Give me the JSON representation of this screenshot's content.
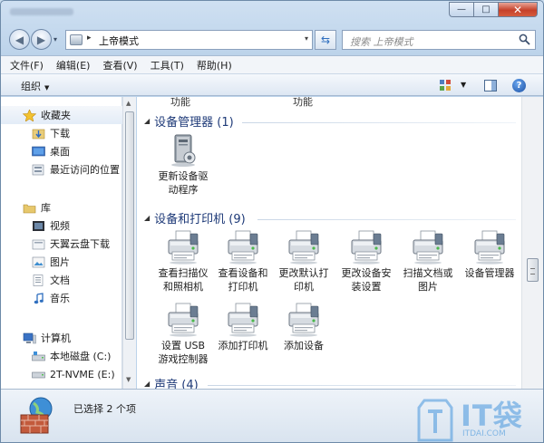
{
  "window": {
    "min_glyph": "—",
    "max_glyph": "□",
    "close_glyph": "✕"
  },
  "address": {
    "back_glyph": "◀",
    "forward_glyph": "▶",
    "recent_glyph": "▾",
    "separator": "▸",
    "crumb": "上帝模式",
    "dropdown_glyph": "▾",
    "refresh_glyph": "⇆",
    "search_placeholder": "搜索 上帝模式"
  },
  "menubar": {
    "items": [
      "文件(F)",
      "编辑(E)",
      "查看(V)",
      "工具(T)",
      "帮助(H)"
    ]
  },
  "toolbar": {
    "organize_label": "组织",
    "organize_arrow": "▼",
    "view_dropdown": "▼",
    "help_glyph": "?"
  },
  "navpane": {
    "favorites": "收藏夹",
    "favorites_items": [
      "下载",
      "桌面",
      "最近访问的位置"
    ],
    "libraries": "库",
    "libraries_items": [
      "视频",
      "天翼云盘下载",
      "图片",
      "文档",
      "音乐"
    ],
    "computer": "计算机",
    "computer_items": [
      "本地磁盘 (C:)",
      "2T-NVME (E:)"
    ],
    "scroll_up": "▲",
    "scroll_down": "▼"
  },
  "content": {
    "cutoff_labels": [
      "功能",
      "功能"
    ],
    "group_device_manager": {
      "title": "设备管理器 (1)",
      "items": [
        "更新设备驱\n动程序"
      ]
    },
    "group_devices_printers": {
      "title": "设备和打印机 (9)",
      "items": [
        "查看扫描仪\n和照相机",
        "查看设备和\n打印机",
        "更改默认打\n印机",
        "更改设备安\n装设置",
        "扫描文档或\n图片",
        "设备管理器",
        "设置 USB\n游戏控制器",
        "添加打印机",
        "添加设备"
      ]
    },
    "group_sound": {
      "title": "声音 (4)"
    },
    "collapse_glyph": "◢"
  },
  "status": {
    "text": "已选择 2 个项"
  },
  "watermark": {
    "text": "IT袋",
    "url": "ITDAI.COM"
  }
}
